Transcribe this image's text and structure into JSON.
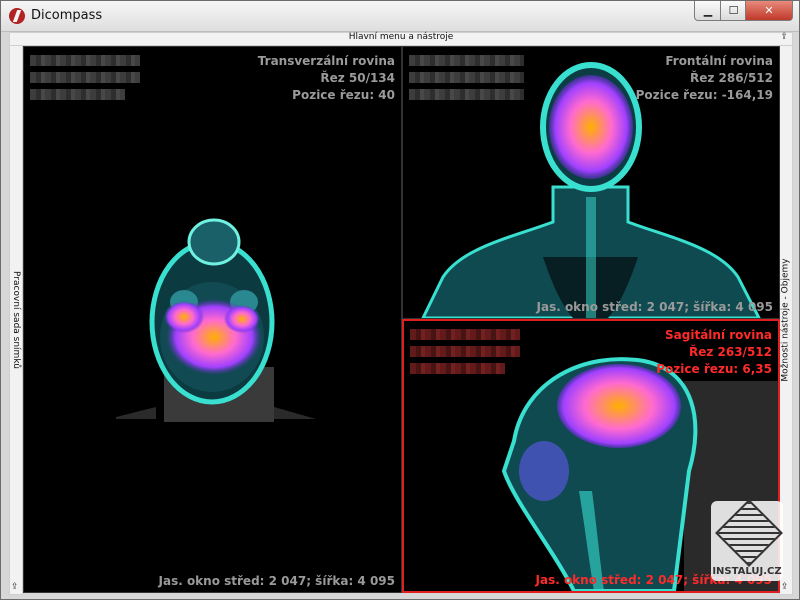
{
  "window": {
    "title": "Dicompass",
    "controls": {
      "minimize": "▁",
      "maximize": "☐",
      "close": "✕"
    }
  },
  "menubar": {
    "label": "Hlavní menu a nástroje",
    "pin": "⇪"
  },
  "left_panel": {
    "label": "Pracovní sada snímků",
    "pin": "⇪"
  },
  "right_panel": {
    "label": "Možnosti nástroje - Objemy",
    "pin": "⇪"
  },
  "viewports": {
    "transversal": {
      "plane": "Transverzální rovina",
      "slice": "Řez 50/134",
      "position": "Pozice řezu: 40",
      "window": "Jas. okno střed: 2 047; šířka: 4 095"
    },
    "frontal": {
      "plane": "Frontální rovina",
      "slice": "Řez 286/512",
      "position": "Pozice řezu: -164,19",
      "window": "Jas. okno střed: 2 047; šířka: 4 095"
    },
    "sagittal": {
      "plane": "Sagitální rovina",
      "slice": "Řez 263/512",
      "position": "Pozice řezu: 6,35",
      "window": "Jas. okno střed: 2 047; šířka: 4 095"
    }
  },
  "watermark": {
    "text": "INSTALUJ.CZ"
  },
  "colors": {
    "active_view_border": "#e02020",
    "info_text": "#9a9a9a",
    "active_info_text": "#ff2a2a",
    "ct_overlay": "#39e0d0",
    "pet_hot": "#ff8a00",
    "pet_mid": "#c040ff"
  }
}
